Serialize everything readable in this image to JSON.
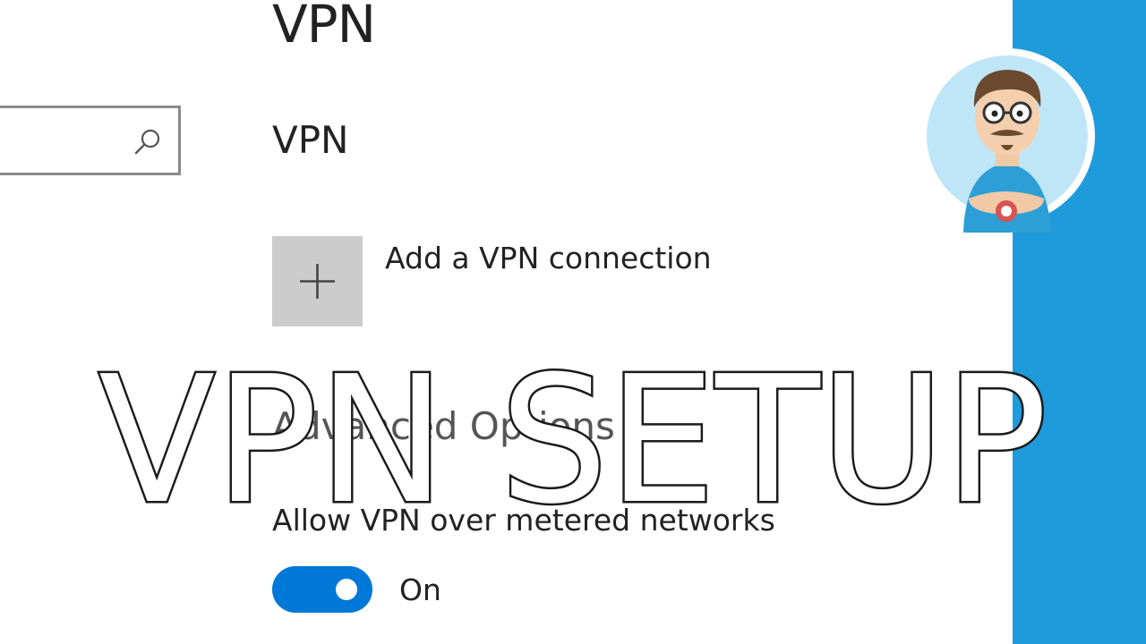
{
  "header": {
    "page_title": "VPN"
  },
  "search": {
    "icon": "search-icon"
  },
  "vpn_section": {
    "title": "VPN",
    "add_connection_label": "Add a VPN connection",
    "add_icon": "plus-icon"
  },
  "advanced": {
    "title": "Advanced Options",
    "metered_label": "Allow VPN over metered networks",
    "metered_toggle_state": "On",
    "metered_toggle_on": true
  },
  "overlay": {
    "text": "VPN SETUP"
  },
  "colors": {
    "accent": "#0078d7",
    "side_strip": "#1e9bdb",
    "tile": "#cccccc",
    "text": "#222222"
  }
}
